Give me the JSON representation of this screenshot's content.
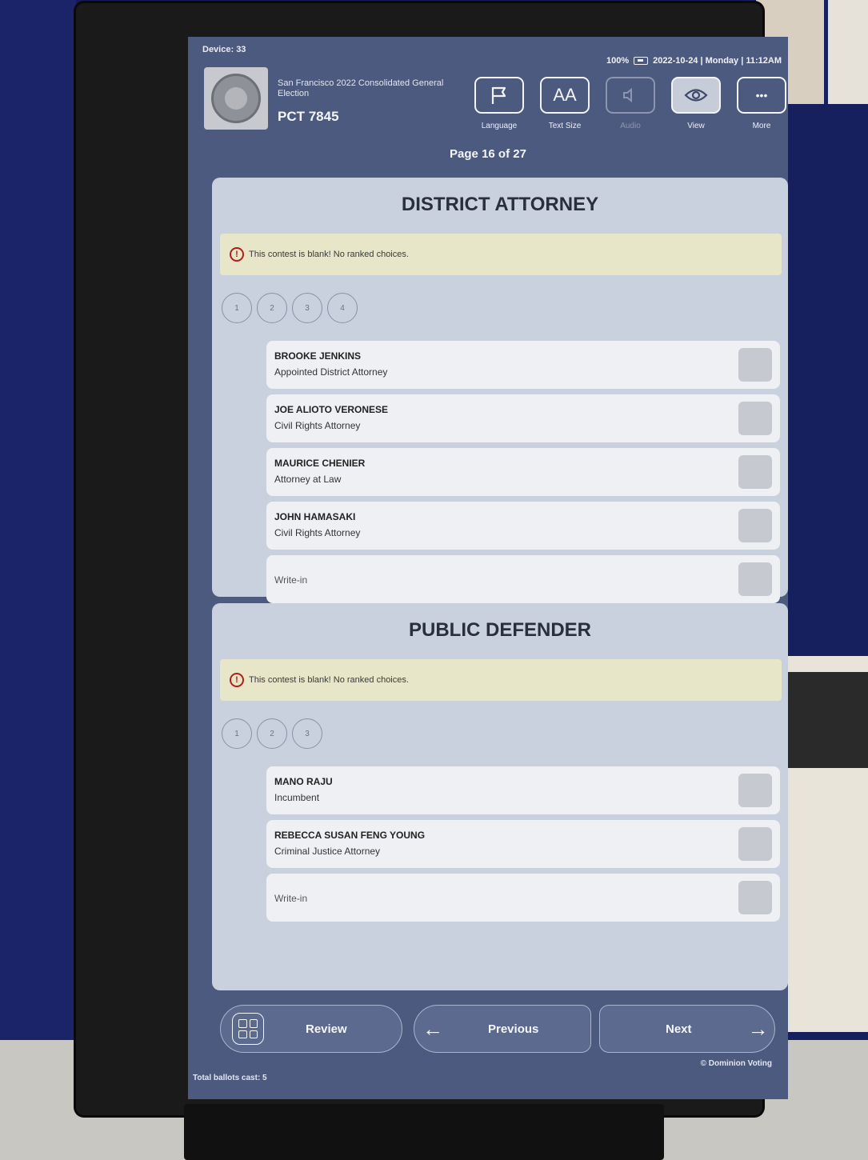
{
  "header": {
    "device": "Device: 33",
    "battery": "100%",
    "datetime": "2022-10-24 | Monday | 11:12AM",
    "election_title": "San Francisco 2022 Consolidated General Election",
    "precinct": "PCT 7845",
    "page_indicator": "Page 16 of 27"
  },
  "toolbar": {
    "language": "Language",
    "text_size": "Text Size",
    "text_size_glyph": "AA",
    "audio": "Audio",
    "view": "View",
    "more": "More",
    "more_glyph": "•••"
  },
  "contests": [
    {
      "title": "DISTRICT ATTORNEY",
      "warning": "This contest is blank! No ranked choices.",
      "ranks": [
        "1",
        "2",
        "3",
        "4"
      ],
      "candidates": [
        {
          "name": "BROOKE JENKINS",
          "desc": "Appointed District Attorney"
        },
        {
          "name": "JOE ALIOTO VERONESE",
          "desc": "Civil Rights Attorney"
        },
        {
          "name": "MAURICE CHENIER",
          "desc": "Attorney at Law"
        },
        {
          "name": "JOHN HAMASAKI",
          "desc": "Civil Rights Attorney"
        }
      ],
      "writein": "Write-in"
    },
    {
      "title": "PUBLIC DEFENDER",
      "warning": "This contest is blank! No ranked choices.",
      "ranks": [
        "1",
        "2",
        "3"
      ],
      "candidates": [
        {
          "name": "MANO RAJU",
          "desc": "Incumbent"
        },
        {
          "name": "REBECCA SUSAN FENG YOUNG",
          "desc": "Criminal Justice Attorney"
        }
      ],
      "writein": "Write-in"
    }
  ],
  "nav": {
    "review": "Review",
    "previous": "Previous",
    "next": "Next"
  },
  "footer": {
    "ballots_cast": "Total ballots cast: 5",
    "copyright": "© Dominion Voting"
  },
  "colors": {
    "screen_bg": "#4d5a7f",
    "card_bg": "#c9d1de",
    "warning_bg": "#e8e6c8",
    "warning_icon": "#b01e1e"
  }
}
